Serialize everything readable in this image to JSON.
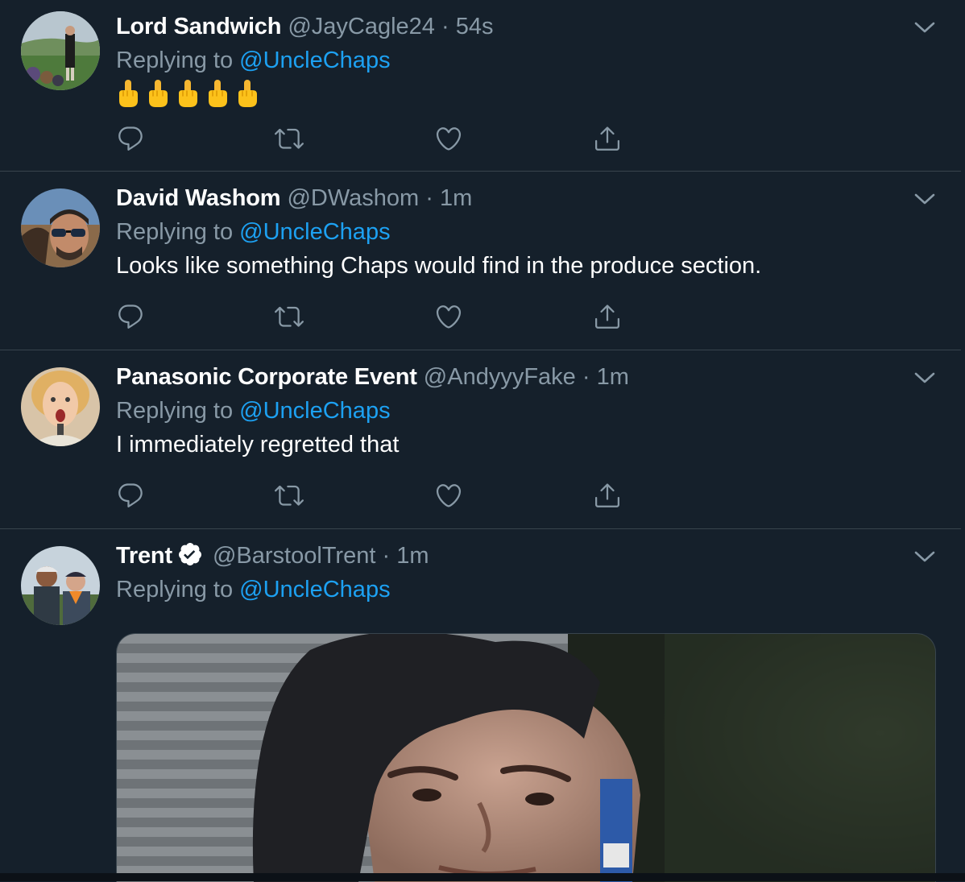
{
  "replying_prefix": "Replying to",
  "tweets": [
    {
      "name": "Lord Sandwich",
      "handle": "@JayCagle24",
      "separator": "·",
      "time": "54s",
      "mention": "@UncleChaps",
      "text": "",
      "emoji_count": 5,
      "avatar_icon": "golf-course-avatar"
    },
    {
      "name": "David Washom",
      "handle": "@DWashom",
      "separator": "·",
      "time": "1m",
      "mention": "@UncleChaps",
      "text": "Looks like something Chaps would find in the produce section.",
      "avatar_icon": "sunglasses-selfie-avatar"
    },
    {
      "name": "Panasonic Corporate Event",
      "handle": "@AndyyyFake",
      "separator": "·",
      "time": "1m",
      "mention": "@UncleChaps",
      "text": "I immediately regretted that",
      "avatar_icon": "singer-avatar"
    },
    {
      "name": "Trent",
      "handle": "@BarstoolTrent",
      "separator": "·",
      "time": "1m",
      "mention": "@UncleChaps",
      "text": "",
      "verified": true,
      "avatar_icon": "two-men-outdoors-avatar"
    }
  ],
  "icons": {
    "reply": "reply-icon",
    "retweet": "retweet-icon",
    "like": "like-icon",
    "share": "share-icon",
    "more": "chevron-down-icon",
    "verified": "verified-badge-icon"
  },
  "colors": {
    "background": "#15202b",
    "divider": "#38444d",
    "secondary_text": "#8899a6",
    "link": "#1da1f2",
    "primary_text": "#ffffff"
  }
}
